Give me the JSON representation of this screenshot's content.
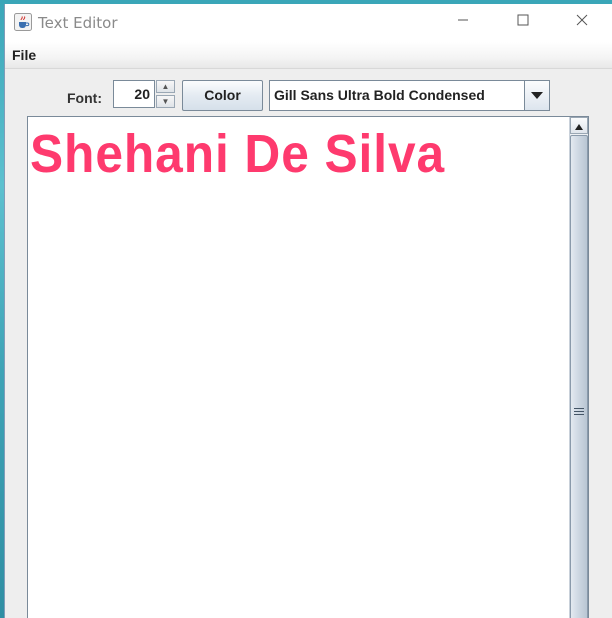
{
  "window": {
    "title": "Text Editor"
  },
  "menubar": {
    "items": [
      {
        "label": "File"
      }
    ]
  },
  "toolbar": {
    "font_label": "Font:",
    "font_size_value": "20",
    "color_button_label": "Color",
    "font_family_selected": "Gill Sans Ultra Bold Condensed"
  },
  "editor": {
    "content": "Shehani De Silva",
    "text_color": "#fe3a6e"
  },
  "icons": {
    "app": "java-cup-icon",
    "minimize": "minimize-icon",
    "maximize": "maximize-icon",
    "close": "close-icon",
    "spin_up": "chevron-up-icon",
    "spin_down": "chevron-down-icon",
    "dropdown": "triangle-down-icon",
    "scroll_up": "scroll-up-arrow-icon"
  }
}
